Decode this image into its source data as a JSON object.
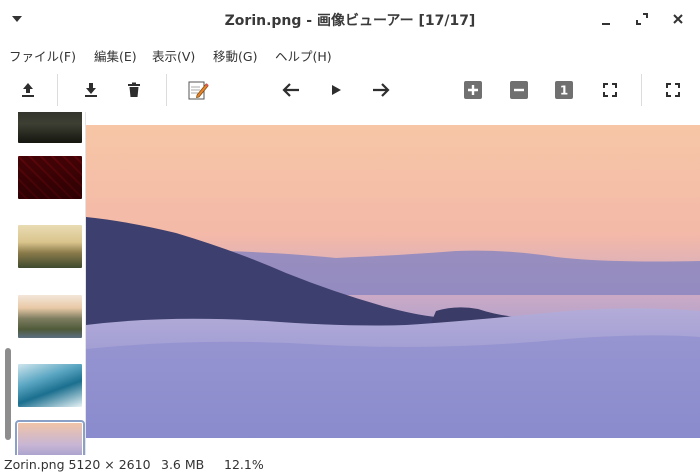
{
  "titlebar": {
    "title": "Zorin.png - 画像ビューアー [17/17]",
    "menu_icon": "triangle-down-icon",
    "minimize_icon": "minimize-icon",
    "maximize_icon": "maximize-icon",
    "close_icon": "close-icon"
  },
  "menubar": {
    "items": [
      {
        "label": "ファイル(F)"
      },
      {
        "label": "編集(E)"
      },
      {
        "label": "表示(V)"
      },
      {
        "label": "移動(G)"
      },
      {
        "label": "ヘルプ(H)"
      }
    ]
  },
  "toolbar": {
    "buttons": [
      {
        "icon": "upload-icon"
      },
      {
        "icon": "download-icon"
      },
      {
        "icon": "trash-icon"
      },
      {
        "icon": "edit-icon"
      },
      {
        "icon": "arrow-left-icon"
      },
      {
        "icon": "play-icon"
      },
      {
        "icon": "arrow-right-icon"
      },
      {
        "icon": "zoom-in-icon"
      },
      {
        "icon": "zoom-out-icon"
      },
      {
        "icon": "zoom-1-icon",
        "label": "1"
      },
      {
        "icon": "fit-icon"
      },
      {
        "icon": "fullscreen-icon"
      }
    ]
  },
  "thumbnails": [
    {
      "name": "dark-landscape"
    },
    {
      "name": "red-pattern"
    },
    {
      "name": "golden-hills"
    },
    {
      "name": "coast-cliffs"
    },
    {
      "name": "ocean-wave"
    },
    {
      "name": "zorin",
      "selected": true
    }
  ],
  "statusbar": {
    "filename_dims": "Zorin.png 5120 × 2610",
    "size": "3.6 MB",
    "zoom": "12.1%"
  }
}
